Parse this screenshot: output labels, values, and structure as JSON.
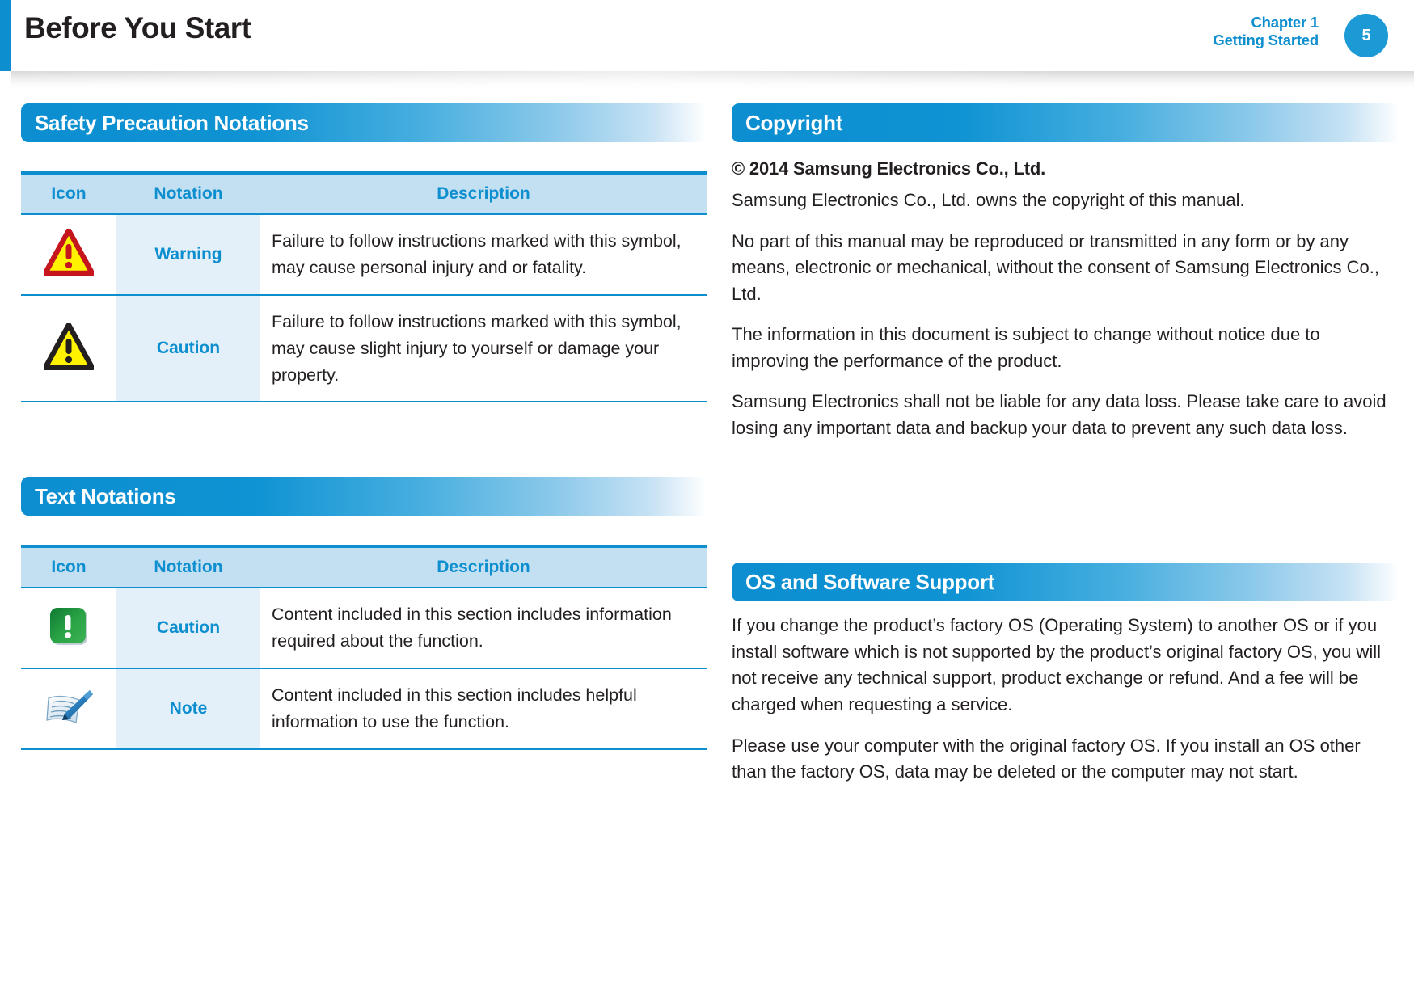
{
  "header": {
    "title": "Before You Start",
    "chapter": "Chapter 1",
    "chapter_section": "Getting Started",
    "page_number": "5",
    "accent_color": "#0d8ecf"
  },
  "left_column": {
    "section_safety": {
      "title": "Safety Precaution Notations",
      "table": {
        "columns": [
          "Icon",
          "Notation",
          "Description"
        ],
        "rows": [
          {
            "icon": "warning-triangle-red-icon",
            "notation": "Warning",
            "description": "Failure to follow instructions marked with this symbol, may cause personal injury and or fatality."
          },
          {
            "icon": "caution-triangle-black-icon",
            "notation": "Caution",
            "description": "Failure to follow instructions marked with this symbol, may cause slight injury to yourself or damage your property."
          }
        ]
      }
    },
    "section_text_notations": {
      "title": "Text Notations",
      "table": {
        "columns": [
          "Icon",
          "Notation",
          "Description"
        ],
        "rows": [
          {
            "icon": "caution-green-square-icon",
            "notation": "Caution",
            "description": "Content included in this section includes information required about the function."
          },
          {
            "icon": "note-pen-paper-icon",
            "notation": "Note",
            "description": "Content included in this section includes helpful information to use the function."
          }
        ]
      }
    }
  },
  "right_column": {
    "section_copyright": {
      "title": "Copyright",
      "lead": "© 2014 Samsung Electronics Co., Ltd.",
      "paragraphs": [
        "Samsung Electronics Co., Ltd. owns the copyright of this manual.",
        "No part of this manual may be reproduced or transmitted in any form or by any means, electronic or mechanical, without the consent of Samsung Electronics Co., Ltd.",
        "The information in this document is subject to change without notice due to improving the performance of the product.",
        "Samsung Electronics shall not be liable for any data loss. Please take care to avoid losing any important data and backup your data to prevent any such data loss."
      ]
    },
    "section_os_support": {
      "title": "OS and Software Support",
      "paragraphs": [
        "If you change the product’s factory OS (Operating System) to another OS or if you install software which is not supported by the product’s original factory OS, you will not receive any technical support, product exchange or refund. And a fee will be charged when requesting a service.",
        "Please use your computer with the original factory OS. If you install an OS other than the factory OS, data may be deleted or the computer may not start."
      ]
    }
  },
  "colors": {
    "brand_blue": "#0d8ecf",
    "table_header_bg": "#c3dff2",
    "notation_cell_bg": "#e3eff9",
    "warning_red": "#c4161c",
    "warning_yellow": "#fff200",
    "caution_green": "#1a9e3f",
    "text_dark": "#231f20"
  }
}
